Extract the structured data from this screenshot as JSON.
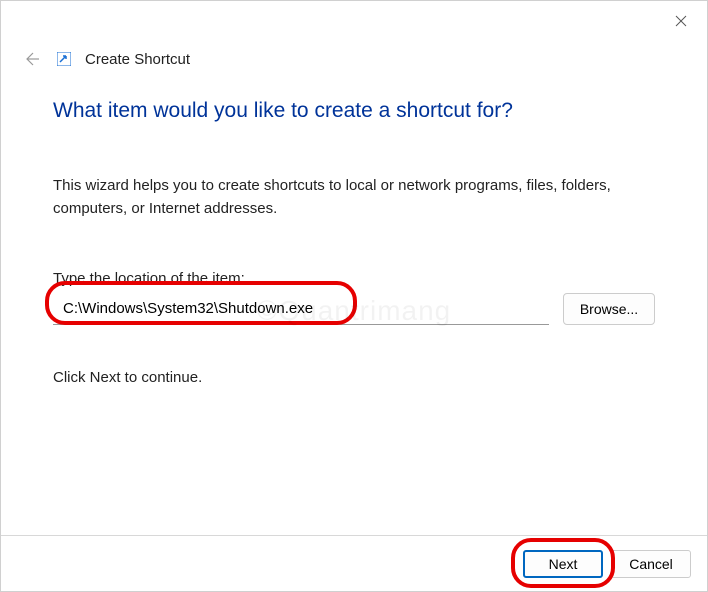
{
  "header": {
    "title": "Create Shortcut"
  },
  "main": {
    "heading": "What item would you like to create a shortcut for?",
    "description": "This wizard helps you to create shortcuts to local or network programs, files, folders, computers, or Internet addresses.",
    "input_label": "Type the location of the item:",
    "input_value": "C:\\Windows\\System32\\Shutdown.exe",
    "browse_label": "Browse...",
    "continue_text": "Click Next to continue."
  },
  "footer": {
    "next_label": "Next",
    "cancel_label": "Cancel"
  },
  "watermark": "©Quantrimang"
}
